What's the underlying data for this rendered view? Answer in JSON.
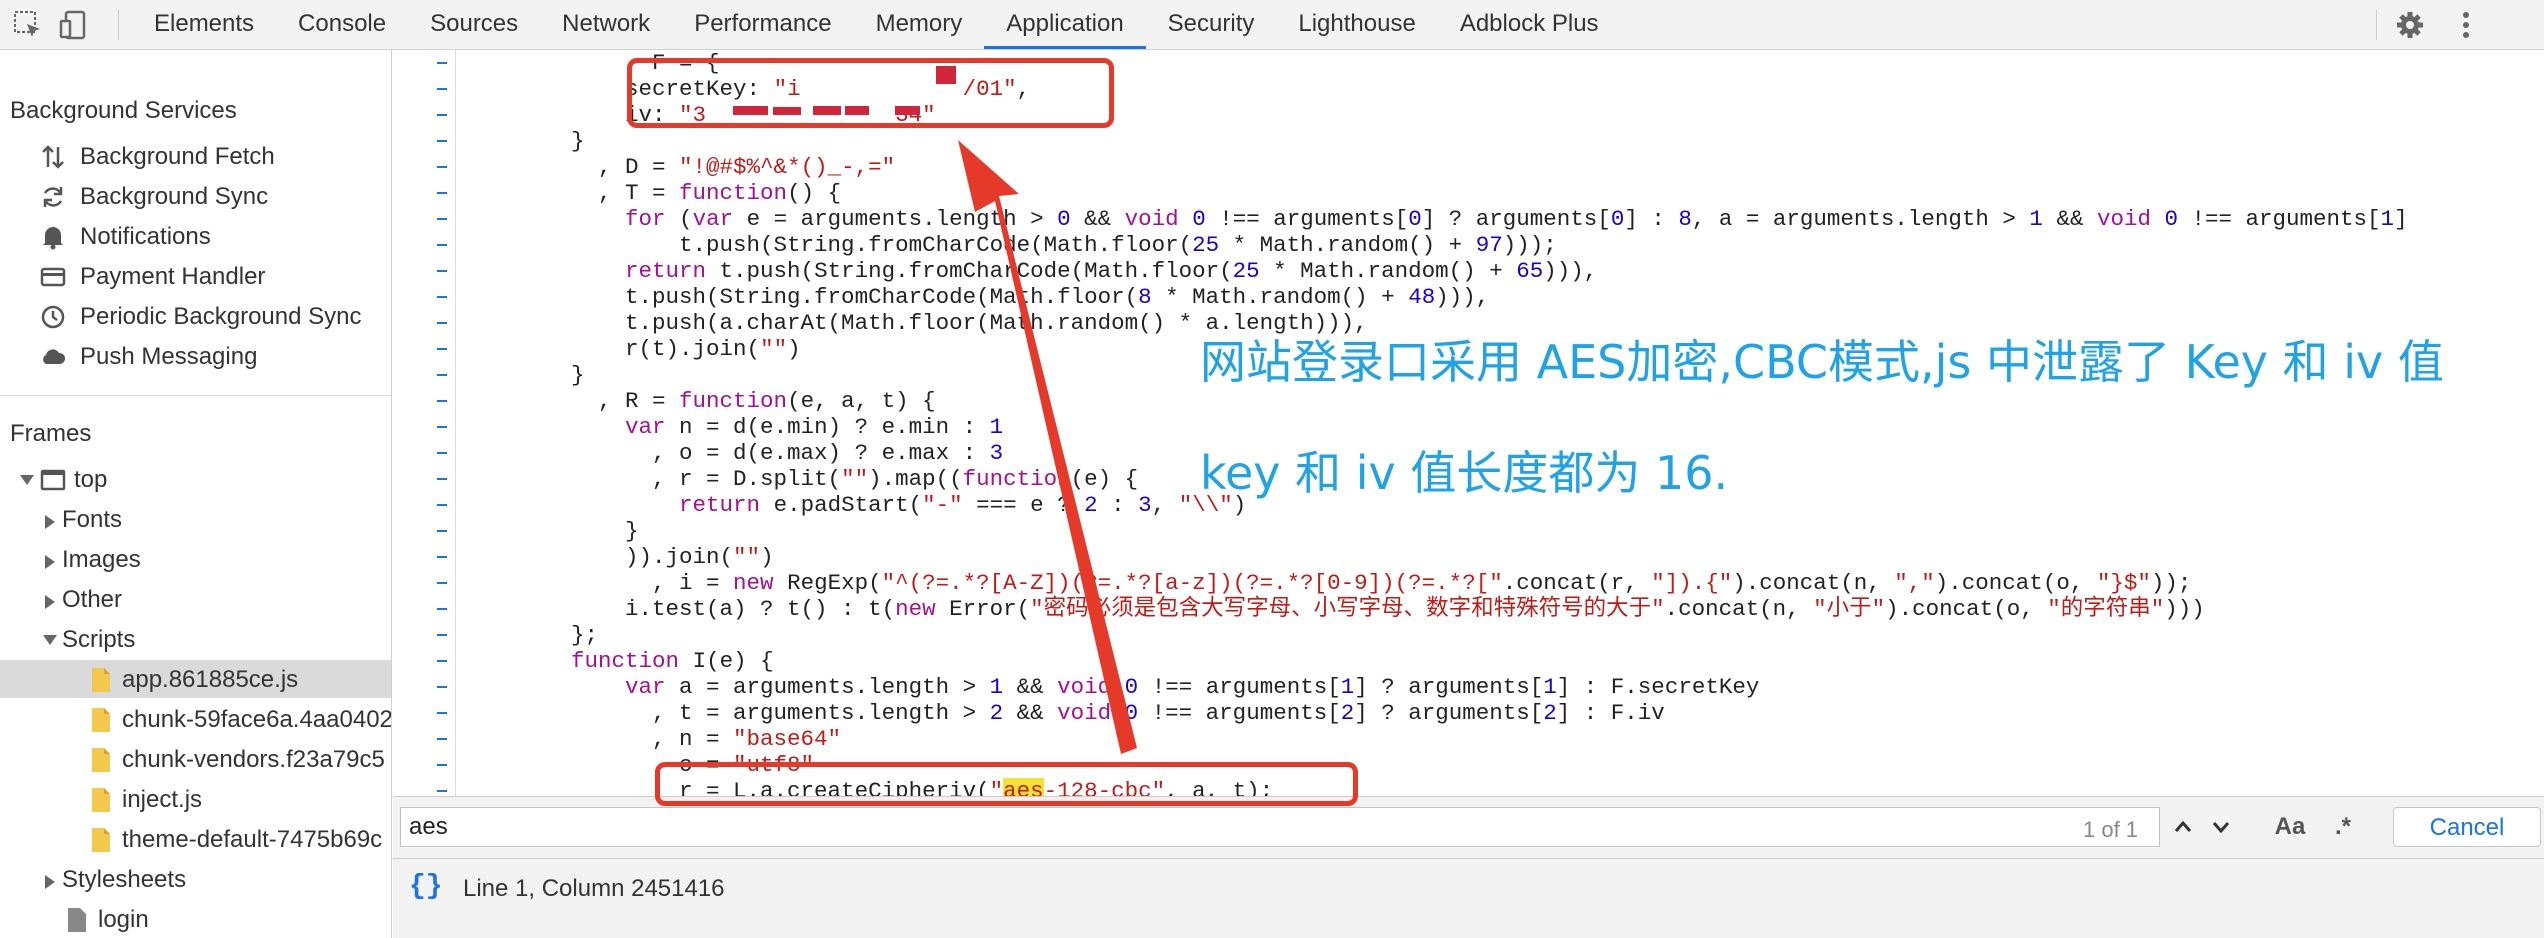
{
  "toolbar": {
    "tabs": [
      "Elements",
      "Console",
      "Sources",
      "Network",
      "Performance",
      "Memory",
      "Application",
      "Security",
      "Lighthouse",
      "Adblock Plus"
    ],
    "active_tab": "Application",
    "icons": [
      "inspect-icon",
      "device-toggle-icon",
      "gear-icon",
      "kebab-menu-icon"
    ]
  },
  "sidebar": {
    "background_services": {
      "header": "Background Services",
      "items": [
        "Background Fetch",
        "Background Sync",
        "Notifications",
        "Payment Handler",
        "Periodic Background Sync",
        "Push Messaging"
      ]
    },
    "frames": {
      "header": "Frames",
      "top": "top",
      "folders": [
        "Fonts",
        "Images",
        "Other",
        "Scripts"
      ],
      "scripts": [
        "app.861885ce.js",
        "chunk-59face6a.4aa0402",
        "chunk-vendors.f23a79c5",
        "inject.js",
        "theme-default-7475b69c"
      ],
      "selected_script": "app.861885ce.js",
      "stylesheets": "Stylesheets",
      "doc": "login"
    }
  },
  "code": {
    "lines": [
      [
        {
          "t": "            , F = {"
        }
      ],
      [
        {
          "t": "            secretKey: "
        },
        {
          "t": "\"i            /01\"",
          "c": "st"
        },
        {
          "t": ","
        }
      ],
      [
        {
          "t": "            iv: "
        },
        {
          "t": "\"3              34\"",
          "c": "st"
        }
      ],
      [
        {
          "t": "        }"
        }
      ],
      [
        {
          "t": "          , D = "
        },
        {
          "t": "\"!@#$%^&*()_-,=\"",
          "c": "st"
        }
      ],
      [
        {
          "t": "          , T = "
        },
        {
          "t": "function",
          "c": "kw"
        },
        {
          "t": "() {"
        }
      ],
      [
        {
          "t": "            "
        },
        {
          "t": "for",
          "c": "kw"
        },
        {
          "t": " ("
        },
        {
          "t": "var",
          "c": "kw"
        },
        {
          "t": " e = arguments.length > "
        },
        {
          "t": "0",
          "c": "fn"
        },
        {
          "t": " && "
        },
        {
          "t": "void",
          "c": "kw"
        },
        {
          "t": " "
        },
        {
          "t": "0",
          "c": "fn"
        },
        {
          "t": " !== arguments["
        },
        {
          "t": "0",
          "c": "fn"
        },
        {
          "t": "] ? arguments["
        },
        {
          "t": "0",
          "c": "fn"
        },
        {
          "t": "] : "
        },
        {
          "t": "8",
          "c": "fn"
        },
        {
          "t": ", a = arguments.length > "
        },
        {
          "t": "1",
          "c": "fn"
        },
        {
          "t": " && "
        },
        {
          "t": "void",
          "c": "kw"
        },
        {
          "t": " "
        },
        {
          "t": "0",
          "c": "fn"
        },
        {
          "t": " !== arguments["
        },
        {
          "t": "1",
          "c": "fn"
        },
        {
          "t": "]"
        }
      ],
      [
        {
          "t": "                t.push(String.fromCharCode(Math.floor("
        },
        {
          "t": "25",
          "c": "fn"
        },
        {
          "t": " * Math.random() + "
        },
        {
          "t": "97",
          "c": "fn"
        },
        {
          "t": ")));"
        }
      ],
      [
        {
          "t": "            "
        },
        {
          "t": "return",
          "c": "kw"
        },
        {
          "t": " t.push(String.fromCharCode(Math.floor("
        },
        {
          "t": "25",
          "c": "fn"
        },
        {
          "t": " * Math.random() + "
        },
        {
          "t": "65",
          "c": "fn"
        },
        {
          "t": "))),"
        }
      ],
      [
        {
          "t": "            t.push(String.fromCharCode(Math.floor("
        },
        {
          "t": "8",
          "c": "fn"
        },
        {
          "t": " * Math.random() + "
        },
        {
          "t": "48",
          "c": "fn"
        },
        {
          "t": "))),"
        }
      ],
      [
        {
          "t": "            t.push(a.charAt(Math.floor(Math.random() * a.length))),"
        }
      ],
      [
        {
          "t": "            r(t).join("
        },
        {
          "t": "\"\"",
          "c": "st"
        },
        {
          "t": ")"
        }
      ],
      [
        {
          "t": "        }"
        }
      ],
      [
        {
          "t": "          , R = "
        },
        {
          "t": "function",
          "c": "kw"
        },
        {
          "t": "(e, a, t) {"
        }
      ],
      [
        {
          "t": "            "
        },
        {
          "t": "var",
          "c": "kw"
        },
        {
          "t": " n = d(e.min) ? e.min : "
        },
        {
          "t": "1",
          "c": "fn"
        }
      ],
      [
        {
          "t": "              , o = d(e.max) ? e.max : "
        },
        {
          "t": "3",
          "c": "fn"
        }
      ],
      [
        {
          "t": "              , r = D.split("
        },
        {
          "t": "\"\"",
          "c": "st"
        },
        {
          "t": ").map(("
        },
        {
          "t": "function",
          "c": "kw"
        },
        {
          "t": "(e) {"
        }
      ],
      [
        {
          "t": "                "
        },
        {
          "t": "return",
          "c": "kw"
        },
        {
          "t": " e.padStart("
        },
        {
          "t": "\"-\"",
          "c": "st"
        },
        {
          "t": " === e ? "
        },
        {
          "t": "2",
          "c": "fn"
        },
        {
          "t": " : "
        },
        {
          "t": "3",
          "c": "fn"
        },
        {
          "t": ", "
        },
        {
          "t": "\"\\\\\"",
          "c": "st"
        },
        {
          "t": ")"
        }
      ],
      [
        {
          "t": "            }"
        }
      ],
      [
        {
          "t": "            )).join("
        },
        {
          "t": "\"\"",
          "c": "st"
        },
        {
          "t": ")"
        }
      ],
      [
        {
          "t": "              , i = "
        },
        {
          "t": "new",
          "c": "kw"
        },
        {
          "t": " RegExp("
        },
        {
          "t": "\"^(?=.*?[A-Z])(?=.*?[a-z])(?=.*?[0-9])(?=.*?[\"",
          "c": "st"
        },
        {
          "t": ".concat(r, "
        },
        {
          "t": "\"]).{\"",
          "c": "st"
        },
        {
          "t": ").concat(n, "
        },
        {
          "t": "\",\"",
          "c": "st"
        },
        {
          "t": ").concat(o, "
        },
        {
          "t": "\"}$\"",
          "c": "st"
        },
        {
          "t": "));"
        }
      ],
      [
        {
          "t": "            i.test(a) ? t() : t("
        },
        {
          "t": "new",
          "c": "kw"
        },
        {
          "t": " Error("
        },
        {
          "t": "\"密码必须是包含大写字母、小写字母、数字和特殊符号的大于\"",
          "c": "st"
        },
        {
          "t": ".concat(n, "
        },
        {
          "t": "\"小于\"",
          "c": "st"
        },
        {
          "t": ").concat(o, "
        },
        {
          "t": "\"的字符串\"",
          "c": "st"
        },
        {
          "t": ")))"
        }
      ],
      [
        {
          "t": "        };"
        }
      ],
      [
        {
          "t": "        "
        },
        {
          "t": "function",
          "c": "kw"
        },
        {
          "t": " I(e) {"
        }
      ],
      [
        {
          "t": "            "
        },
        {
          "t": "var",
          "c": "kw"
        },
        {
          "t": " a = arguments.length > "
        },
        {
          "t": "1",
          "c": "fn"
        },
        {
          "t": " && "
        },
        {
          "t": "void",
          "c": "kw"
        },
        {
          "t": " "
        },
        {
          "t": "0",
          "c": "fn"
        },
        {
          "t": " !== arguments["
        },
        {
          "t": "1",
          "c": "fn"
        },
        {
          "t": "] ? arguments["
        },
        {
          "t": "1",
          "c": "fn"
        },
        {
          "t": "] : F.secretKey"
        }
      ],
      [
        {
          "t": "              , t = arguments.length > "
        },
        {
          "t": "2",
          "c": "fn"
        },
        {
          "t": " && "
        },
        {
          "t": "void",
          "c": "kw"
        },
        {
          "t": " "
        },
        {
          "t": "0",
          "c": "fn"
        },
        {
          "t": " !== arguments["
        },
        {
          "t": "2",
          "c": "fn"
        },
        {
          "t": "] ? arguments["
        },
        {
          "t": "2",
          "c": "fn"
        },
        {
          "t": "] : F.iv"
        }
      ],
      [
        {
          "t": "              , n = "
        },
        {
          "t": "\"base64\"",
          "c": "st"
        }
      ],
      [
        {
          "t": "              , o = "
        },
        {
          "t": "\"utf8\"",
          "c": "st"
        }
      ],
      [
        {
          "t": "              , r = L.a.createCipheriv("
        },
        {
          "t": "\"",
          "c": "st"
        },
        {
          "t": "aes",
          "c": "st hl"
        },
        {
          "t": "-128-cbc\"",
          "c": "st"
        },
        {
          "t": ", a, t);"
        }
      ]
    ]
  },
  "search": {
    "value": "aes",
    "match_count": "1 of 1",
    "case_label": "Aa",
    "regex_label": ".*",
    "cancel_label": "Cancel"
  },
  "status": {
    "braces": "{}",
    "position": "Line 1, Column 2451416"
  },
  "annotations": {
    "line1": "网站登录口采用 AES加密,CBC模式,js 中泄露了 Key 和 iv 值",
    "line2": "key 和 iv 值长度都为 16.",
    "arrow_color": "#e53a2a",
    "text_color": "#1fa3e6"
  }
}
